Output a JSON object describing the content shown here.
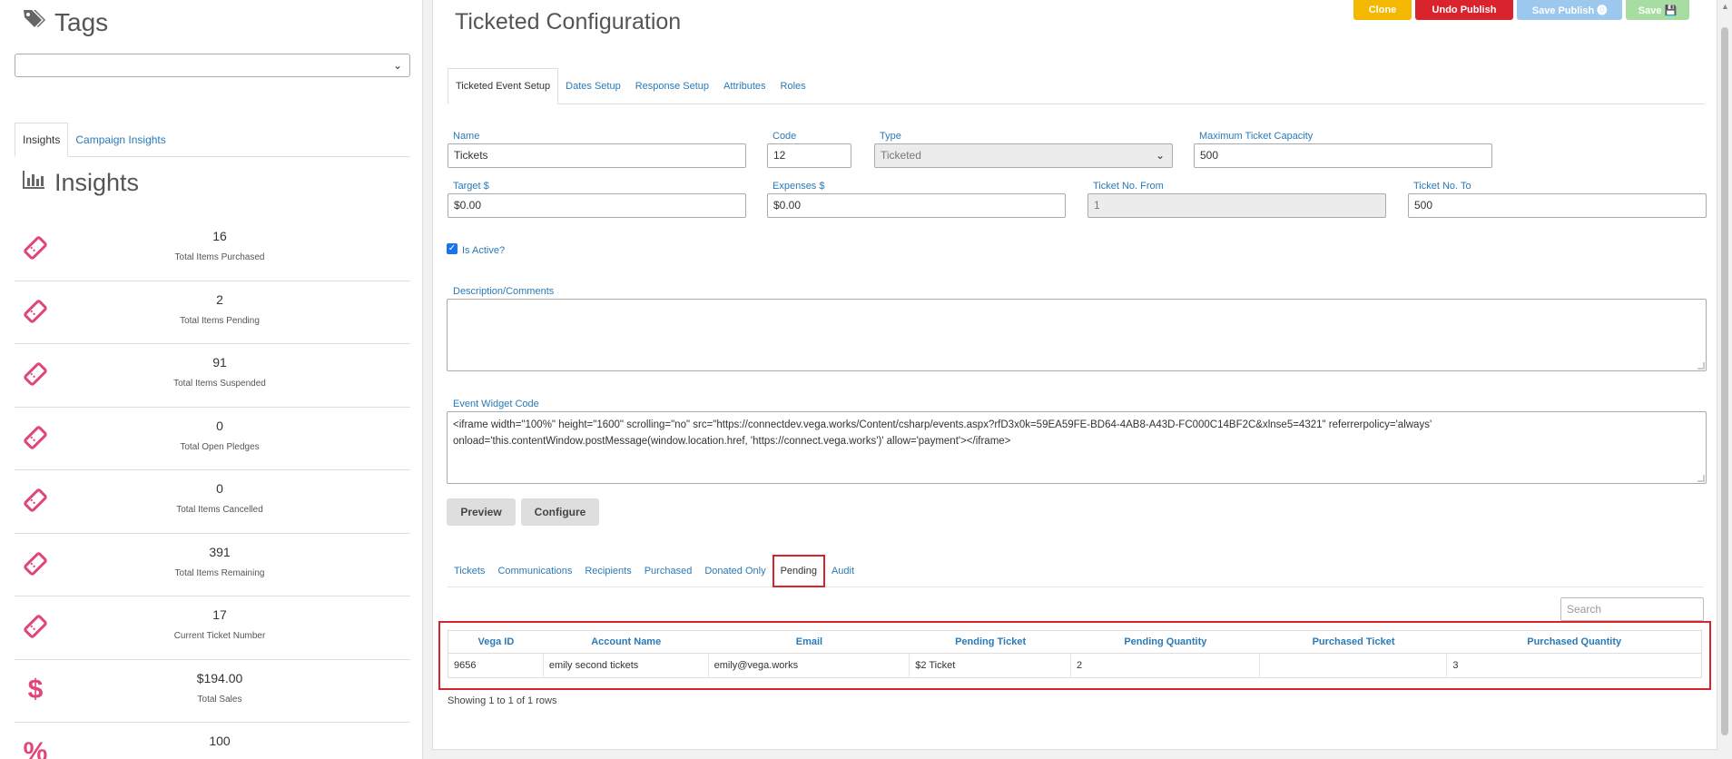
{
  "left": {
    "tags_title": "Tags",
    "tag_select_value": "",
    "tabs": [
      "Insights",
      "Campaign Insights"
    ],
    "insights_title": "Insights",
    "metrics": [
      {
        "value": "16",
        "label": "Total Items Purchased",
        "icon": "ticket-icon"
      },
      {
        "value": "2",
        "label": "Total Items Pending",
        "icon": "ticket-icon"
      },
      {
        "value": "91",
        "label": "Total Items Suspended",
        "icon": "ticket-icon"
      },
      {
        "value": "0",
        "label": "Total Open Pledges",
        "icon": "ticket-icon"
      },
      {
        "value": "0",
        "label": "Total Items Cancelled",
        "icon": "ticket-icon"
      },
      {
        "value": "391",
        "label": "Total Items Remaining",
        "icon": "ticket-icon"
      },
      {
        "value": "17",
        "label": "Current Ticket Number",
        "icon": "ticket-icon"
      },
      {
        "value": "$194.00",
        "label": "Total Sales",
        "icon": "dollar-icon",
        "glyph": "$"
      },
      {
        "value": "100",
        "label": "",
        "icon": "percent-icon",
        "glyph": "%"
      }
    ],
    "accent": "#e0457b"
  },
  "main": {
    "title": "Ticketed Configuration",
    "buttons": {
      "clone": "Clone",
      "undo_publish": "Undo Publish",
      "save_publish": "Save Publish ⓿",
      "save": "Save 💾"
    },
    "tabs": [
      "Ticketed Event Setup",
      "Dates Setup",
      "Response Setup",
      "Attributes",
      "Roles"
    ],
    "fields": {
      "name_label": "Name",
      "name_value": "Tickets",
      "code_label": "Code",
      "code_value": "12",
      "type_label": "Type",
      "type_value": "Ticketed",
      "max_label": "Maximum Ticket Capacity",
      "max_value": "500",
      "target_label": "Target $",
      "target_value": "$0.00",
      "expenses_label": "Expenses $",
      "expenses_value": "$0.00",
      "from_label": "Ticket No. From",
      "from_value": "1",
      "to_label": "Ticket No. To",
      "to_value": "500",
      "active_label": "Is Active?",
      "desc_label": "Description/Comments",
      "desc_value": "",
      "widget_label": "Event Widget Code",
      "widget_value": "<iframe width=\"100%\" height=\"1600\" scrolling=\"no\" src=\"https://connectdev.vega.works/Content/csharp/events.aspx?rfD3x0k=59EA59FE-BD64-4AB8-A43D-FC000C14BF2C&xlnse5=4321\" referrerpolicy='always' onload='this.contentWindow.postMessage(window.location.href, 'https://connect.vega.works')' allow='payment'></iframe>"
    },
    "preview": "Preview",
    "configure": "Configure",
    "sub_tabs": [
      "Tickets",
      "Communications",
      "Recipients",
      "Purchased",
      "Donated Only",
      "Pending",
      "Audit"
    ],
    "search_placeholder": "Search",
    "table": {
      "columns": [
        "Vega ID",
        "Account Name",
        "Email",
        "Pending Ticket",
        "Pending Quantity",
        "Purchased Ticket",
        "Purchased Quantity"
      ],
      "rows": [
        [
          "9656",
          "emily second tickets",
          "emily@vega.works",
          "$2 Ticket",
          "2",
          "",
          "3"
        ]
      ]
    },
    "showing": "Showing 1 to 1 of 1 rows"
  }
}
